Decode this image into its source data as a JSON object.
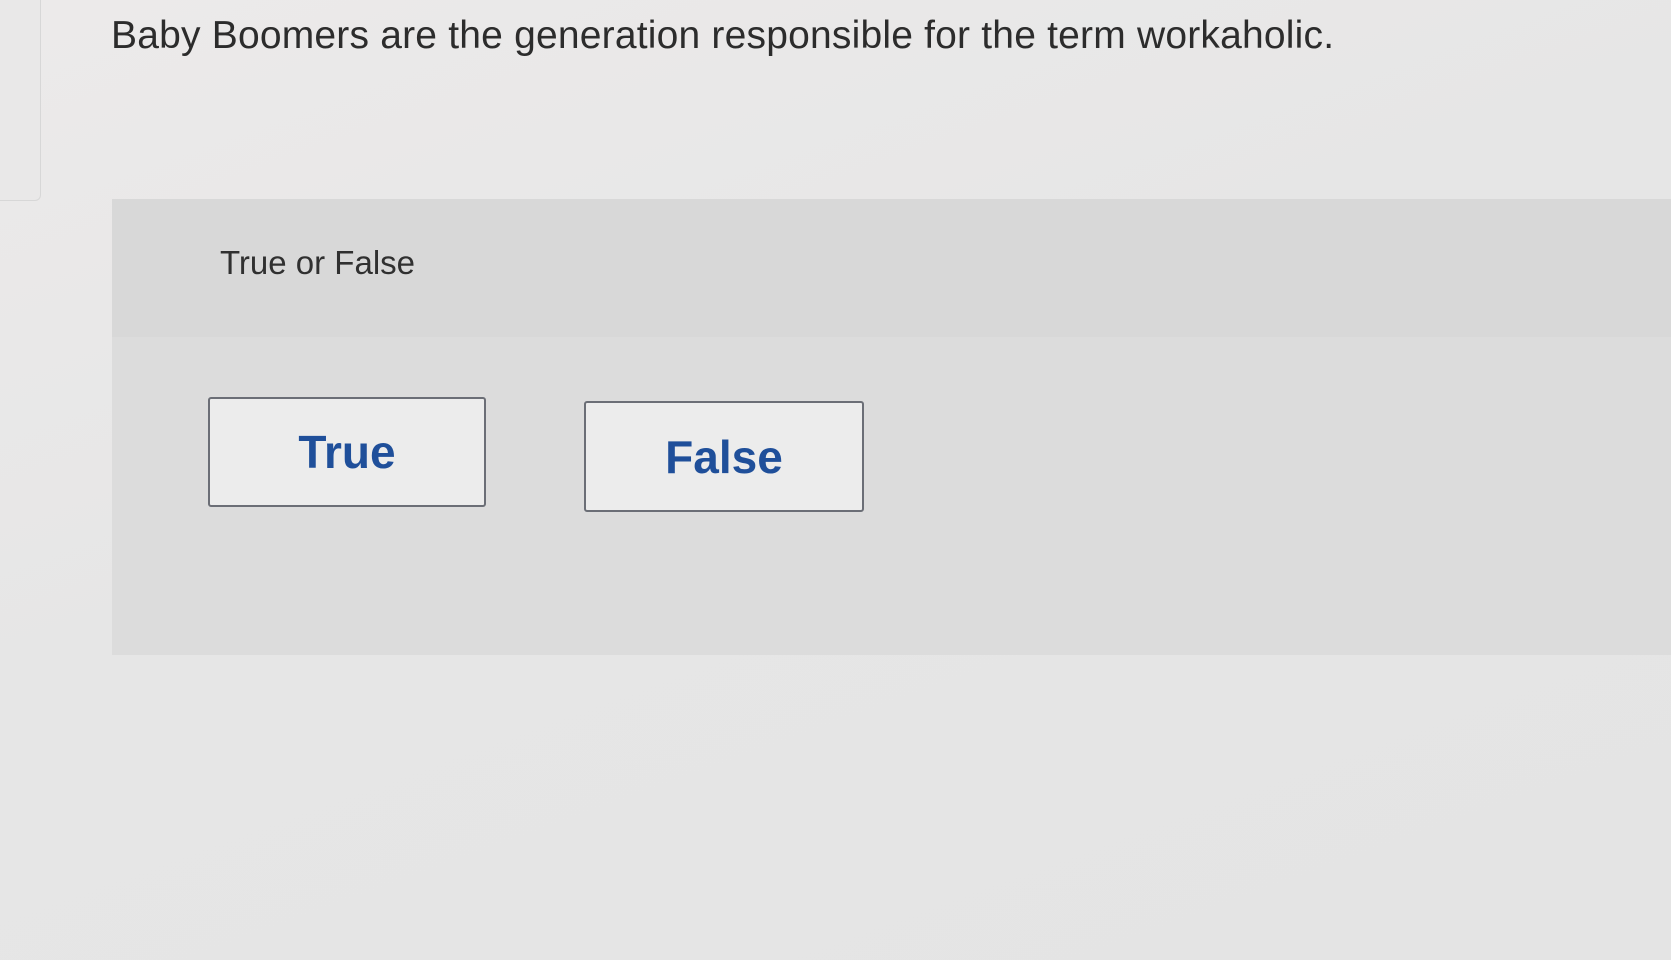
{
  "question": {
    "text": "Baby Boomers are the generation responsible for the term workaholic."
  },
  "prompt": {
    "label": "True or False"
  },
  "choices": [
    {
      "label": "True"
    },
    {
      "label": "False"
    }
  ],
  "colors": {
    "choice_text": "#1f4f9a",
    "choice_border": "#6b6e76",
    "prompt_panel": "#d8d8d8",
    "answer_panel": "#dcdcdc"
  }
}
